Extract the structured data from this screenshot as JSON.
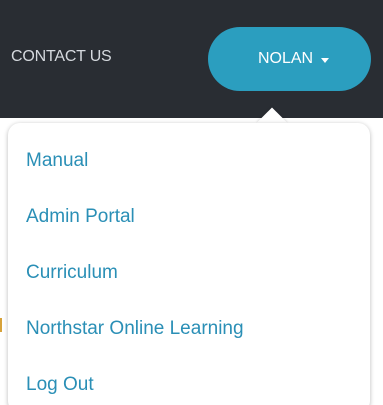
{
  "nav": {
    "contact_label": "CONTACT US",
    "user_label": "NOLAN",
    "caret_icon": "caret-down-icon"
  },
  "dropdown": {
    "items": [
      {
        "label": "Manual"
      },
      {
        "label": "Admin Portal"
      },
      {
        "label": "Curriculum"
      },
      {
        "label": "Northstar Online Learning"
      },
      {
        "label": "Log Out"
      }
    ]
  },
  "colors": {
    "navbar_bg": "#292d33",
    "accent": "#2b9ebf",
    "link": "#2a8fb6"
  }
}
